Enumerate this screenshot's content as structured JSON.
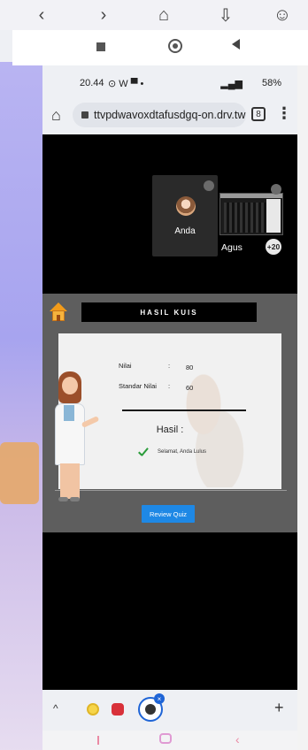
{
  "device_status": {
    "time": "20.44",
    "indicators": "⊙ W ▀ •",
    "battery": "58%"
  },
  "browser": {
    "url": "ttvpdwavoxdtafusdgq-on.drv.tw",
    "tab_count": "8"
  },
  "meeting": {
    "participant_self_name": "Anda",
    "participant_other_name": "Agus",
    "more_participants": "+20"
  },
  "quiz": {
    "title": "HASIL KUIS",
    "score_label": "Nilai",
    "score_value": "80",
    "standard_label": "Standar Nilai",
    "standard_value": "60",
    "separator": ":",
    "result_label": "Hasil :",
    "result_message": "Selamat, Anda Lulus",
    "review_button": "Review Quiz"
  },
  "icons": {
    "check_color": "#2a9c3a",
    "review_button_color": "#1e88e5",
    "title_bar_color": "#000000",
    "panel_color": "#5e5e5e"
  }
}
